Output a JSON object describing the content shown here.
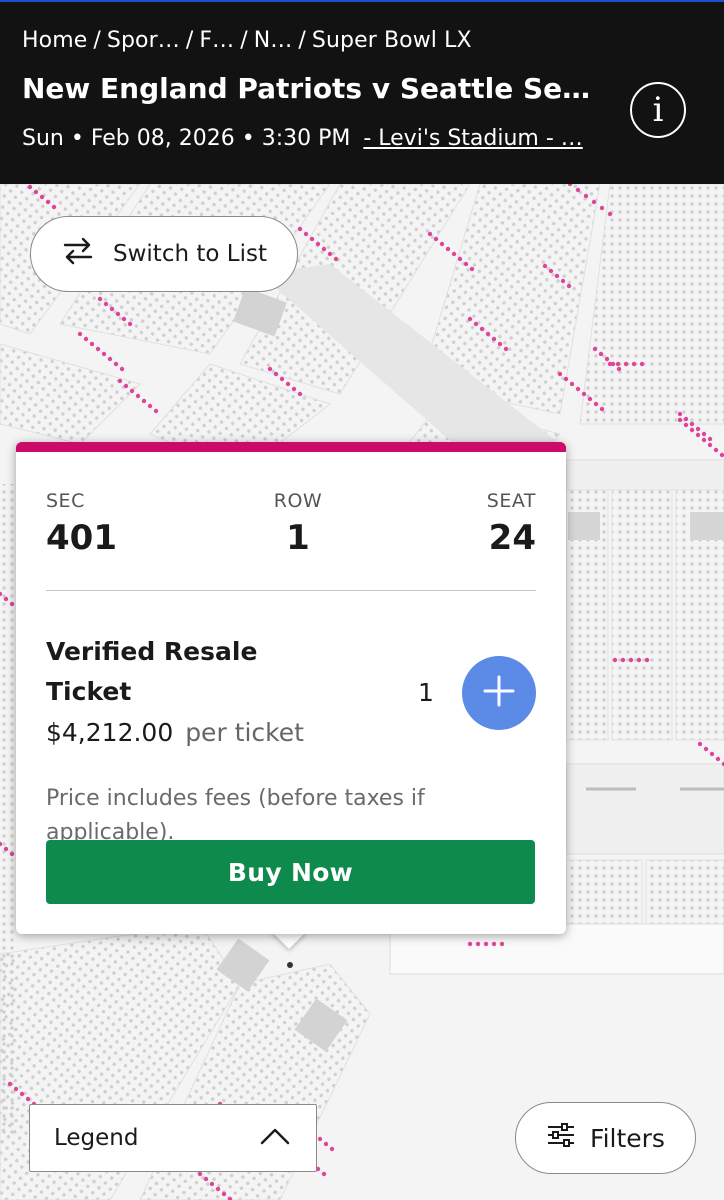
{
  "header": {
    "breadcrumbs": [
      "Home",
      "Spor…",
      "F…",
      "N…",
      "Super Bowl LX"
    ],
    "event_title": "New England Patriots v Seattle Se…",
    "date_time": "Sun • Feb 08, 2026 • 3:30 PM",
    "venue_link": " - Levi's Stadium - …",
    "info_icon": "info-icon"
  },
  "map": {
    "switch_button_label": "Switch to List",
    "switch_icon": "swap-arrows-icon",
    "highlight_color": "#e0449a"
  },
  "popup": {
    "accent_color": "#cc0a6a",
    "sec_label": "SEC",
    "sec_value": "401",
    "row_label": "ROW",
    "row_value": "1",
    "seat_label": "SEAT",
    "seat_value": "24",
    "ticket_type": "Verified Resale Ticket",
    "price": "$4,212.00",
    "price_suffix": "per ticket",
    "quantity": "1",
    "fees_note": "Price includes fees (before taxes if applicable).",
    "buy_button_label": "Buy Now",
    "buy_button_color": "#0d8a4c",
    "add_button_color": "#5b8be6"
  },
  "footer": {
    "legend_label": "Legend",
    "legend_icon": "chevron-up-icon",
    "filters_label": "Filters",
    "filters_icon": "sliders-icon"
  }
}
